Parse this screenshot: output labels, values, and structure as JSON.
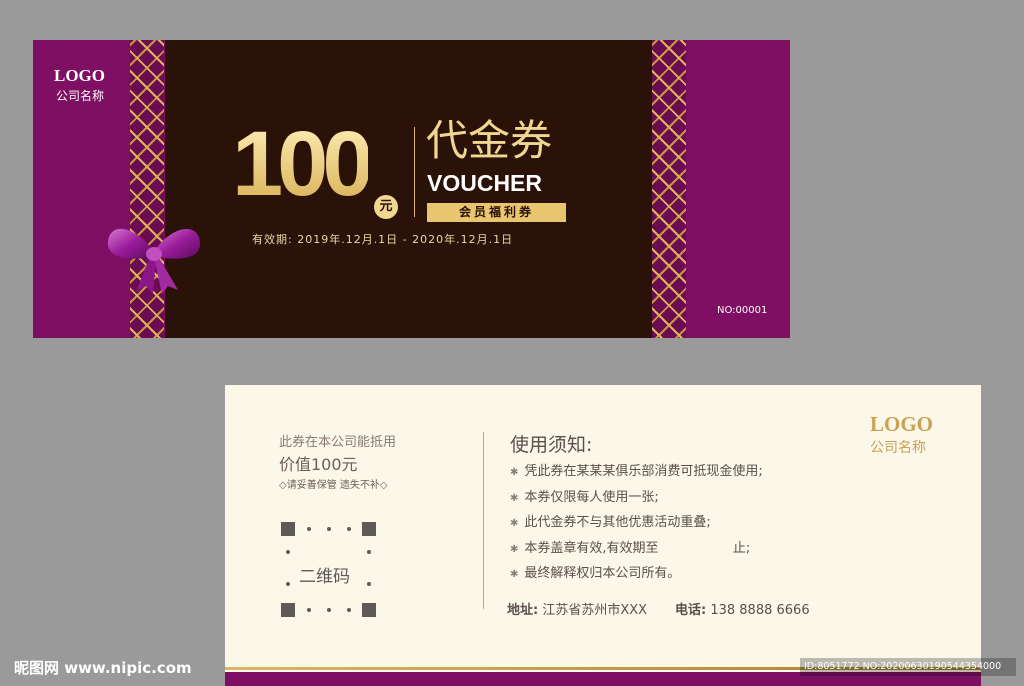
{
  "front": {
    "logo": "LOGO",
    "company": "公司名称",
    "amount": "100",
    "unit": "元",
    "title_cn": "代金券",
    "title_en": "VOUCHER",
    "badge": "会员福利券",
    "validity": "有效期: 2019年.12月.1日 - 2020年.12月.1日",
    "serial": "NO:00001"
  },
  "back": {
    "line1": "此券在本公司能抵用",
    "line2": "价值100元",
    "line3": "◇请妥善保管 遗失不补◇",
    "qr_label": "二维码",
    "rules_title": "使用须知:",
    "rules": [
      "凭此券在某某某俱乐部消费可抵现金使用;",
      "本券仅限每人使用一张;",
      "此代金券不与其他优惠活动重叠;",
      "本券盖章有效,有效期至                  止;",
      "最终解释权归本公司所有。"
    ],
    "address_label": "地址:",
    "address": "江苏省苏州市XXX",
    "tel_label": "电话:",
    "tel": "138 8888 6666",
    "logo": "LOGO",
    "company": "公司名称"
  },
  "watermark": {
    "site": "昵图网 www.nipic.com",
    "id": "ID:8051772 NO:20200630190544354000"
  },
  "colors": {
    "purple": "#7e0f62",
    "dark_brown": "#2a1208",
    "gold": "#e7c66f",
    "cream": "#fbf7e9"
  }
}
